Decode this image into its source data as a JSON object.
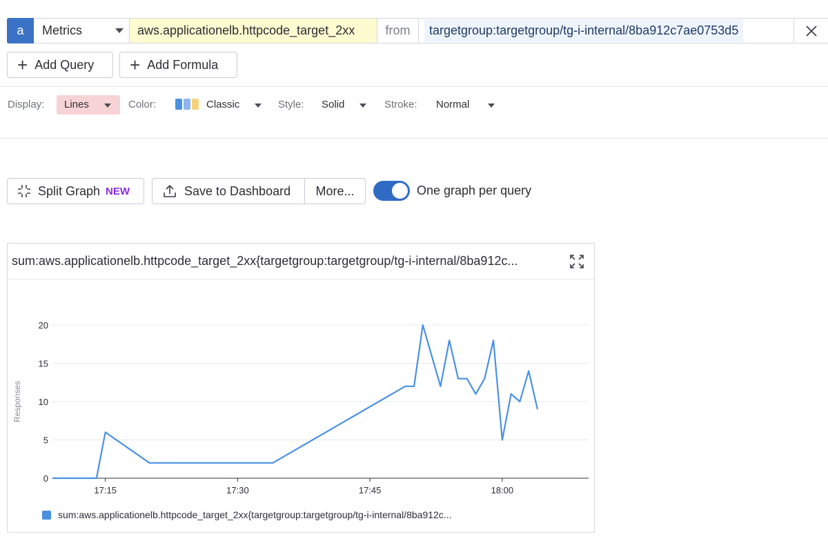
{
  "query": {
    "letter": "a",
    "source": "Metrics",
    "metric": "aws.applicationelb.httpcode_target_2xx",
    "from_label": "from",
    "filter": "targetgroup:targetgroup/tg-i-internal/8ba912c7ae0753d5"
  },
  "buttons": {
    "add_query": "Add Query",
    "add_formula": "Add Formula"
  },
  "display_options": {
    "display_label": "Display:",
    "display_value": "Lines",
    "color_label": "Color:",
    "color_value": "Classic",
    "color_swatch": [
      "#4a90e2",
      "#8fb4ef",
      "#f7d27a"
    ],
    "style_label": "Style:",
    "style_value": "Solid",
    "stroke_label": "Stroke:",
    "stroke_value": "Normal"
  },
  "actions": {
    "split_graph": "Split Graph",
    "new_badge": "NEW",
    "save_to_dashboard": "Save to Dashboard",
    "more": "More...",
    "toggle_label": "One graph per query",
    "toggle_on": true
  },
  "graph": {
    "title": "sum:aws.applicationelb.httpcode_target_2xx{targetgroup:targetgroup/tg-i-internal/8ba912c...",
    "legend": "sum:aws.applicationelb.httpcode_target_2xx{targetgroup:targetgroup/tg-i-internal/8ba912c..."
  },
  "chart_data": {
    "type": "line",
    "ylabel": "Responses",
    "xlabel": "",
    "ylim": [
      0,
      20
    ],
    "yticks": [
      0,
      5,
      10,
      15,
      20
    ],
    "xlim": [
      "17:09",
      "18:04"
    ],
    "xticks": [
      "17:15",
      "17:30",
      "17:45",
      "18:00"
    ],
    "grid": true,
    "color": "#4a90e2",
    "series": [
      {
        "name": "sum:aws.applicationelb.httpcode_target_2xx{targetgroup:targetgroup/tg-i-internal/8ba912c...",
        "x": [
          "17:09",
          "17:14",
          "17:15",
          "17:20",
          "17:34",
          "17:49",
          "17:50",
          "17:51",
          "17:53",
          "17:54",
          "17:55",
          "17:56",
          "17:57",
          "17:58",
          "17:59",
          "18:00",
          "18:01",
          "18:02",
          "18:03",
          "18:04"
        ],
        "values": [
          0,
          0,
          6,
          2,
          2,
          12,
          12,
          20,
          12,
          18,
          13,
          13,
          11,
          13,
          18,
          5,
          11,
          10,
          14,
          9
        ]
      }
    ]
  }
}
